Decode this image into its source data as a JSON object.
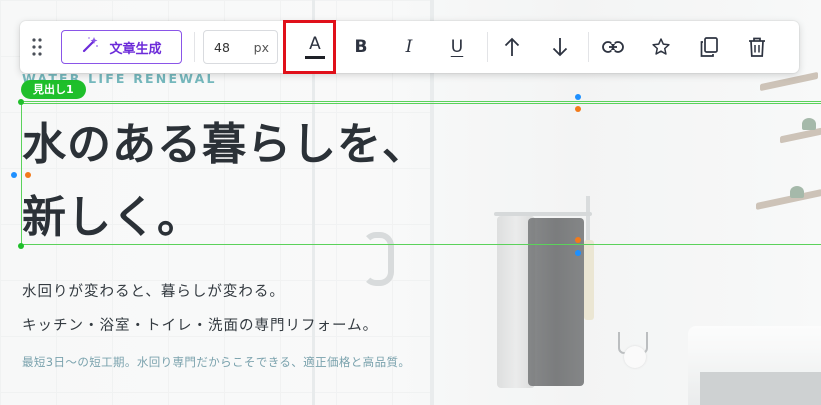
{
  "toolbar": {
    "ai_button_label": "文章生成",
    "font_size_value": "48",
    "font_size_unit": "px",
    "font_color_glyph": "A",
    "bold_glyph": "B",
    "italic_glyph": "I",
    "underline_glyph": "U",
    "icons": [
      "drag-handle-icon",
      "magic-wand-icon",
      "arrow-up-icon",
      "arrow-down-icon",
      "link-icon",
      "star-icon",
      "copy-icon",
      "trash-icon"
    ],
    "accent_color": "#6c2bd9",
    "highlight_color": "#e0101a"
  },
  "selection": {
    "label": "見出し1",
    "color": "#1fbf2b"
  },
  "content": {
    "eyebrow": "WATER LIFE RENEWAL",
    "heading_line1": "水のある暮らしを、",
    "heading_line2": "新しく。",
    "subtitle1": "水回りが変わると、暮らしが変わる。",
    "subtitle2": "キッチン・浴室・トイレ・洗面の専門リフォーム。",
    "note": "最短3日〜の短工期。水回り専門だからこそできる、適正価格と高品質。"
  }
}
